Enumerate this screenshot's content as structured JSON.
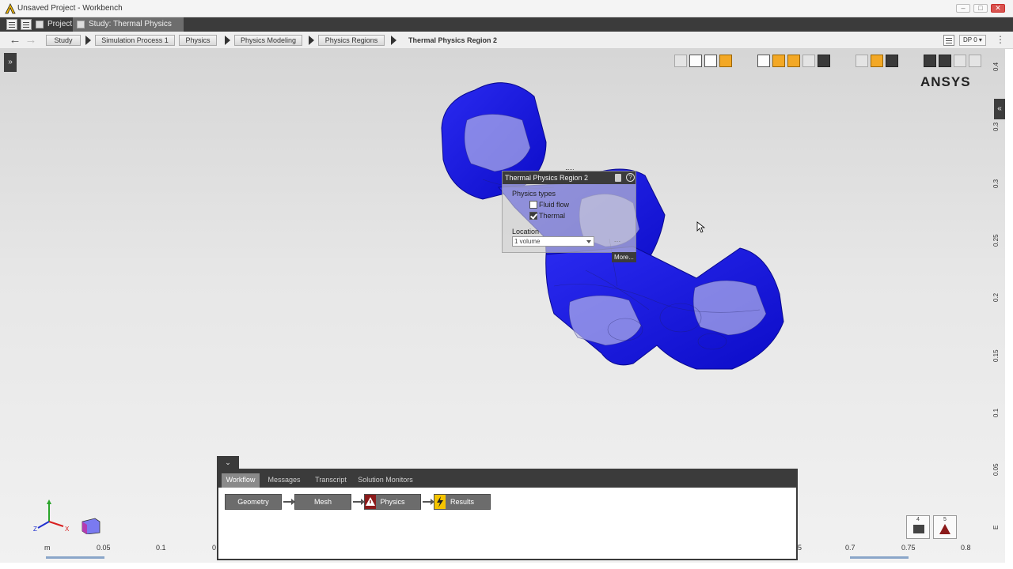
{
  "window": {
    "title": "Unsaved Project - Workbench"
  },
  "tabs": [
    {
      "label": "Project"
    },
    {
      "label": "Study: Thermal Physics Regio..."
    }
  ],
  "breadcrumb": [
    {
      "label": "Study"
    },
    {
      "label": "Simulation Process 1"
    },
    {
      "label": "Physics"
    },
    {
      "label": "Physics Modeling"
    },
    {
      "label": "Physics Regions"
    },
    {
      "label": "Thermal Physics Region 2"
    }
  ],
  "design_point": "DP 0",
  "brand": "ANSYS",
  "properties_panel": {
    "title": "Thermal Physics Region 2",
    "physics_types_label": "Physics types",
    "physics_types": [
      {
        "label": "Fluid flow",
        "checked": false
      },
      {
        "label": "Thermal",
        "checked": true
      }
    ],
    "location_label": "Location",
    "location_value": "1 volume",
    "more_label": "More..."
  },
  "scale": {
    "unit": "m",
    "left_ticks": [
      "0.05",
      "0.1",
      "0"
    ],
    "right_ticks": [
      "5",
      "0.7",
      "0.75",
      "0.8"
    ]
  },
  "ruler": {
    "ticks": [
      "0.4",
      "0.3",
      "0.3",
      "0.25",
      "0.2",
      "0.15",
      "0.1",
      "0.05",
      "E"
    ]
  },
  "status": {
    "messages_count": "4",
    "warnings_count": "5"
  },
  "workflow_panel": {
    "tabs": [
      {
        "label": "Workflow"
      },
      {
        "label": "Messages"
      },
      {
        "label": "Transcript"
      },
      {
        "label": "Solution Monitors"
      }
    ],
    "steps": [
      {
        "label": "Geometry",
        "state": "none"
      },
      {
        "label": "Mesh",
        "state": "none"
      },
      {
        "label": "Physics",
        "state": "warning"
      },
      {
        "label": "Results",
        "state": "update"
      }
    ]
  },
  "colors": {
    "model_blue": "#1414e6",
    "panel_dark": "#3b3b3b",
    "warning_red": "#8b1a1a",
    "update_yellow": "#f5c400"
  }
}
